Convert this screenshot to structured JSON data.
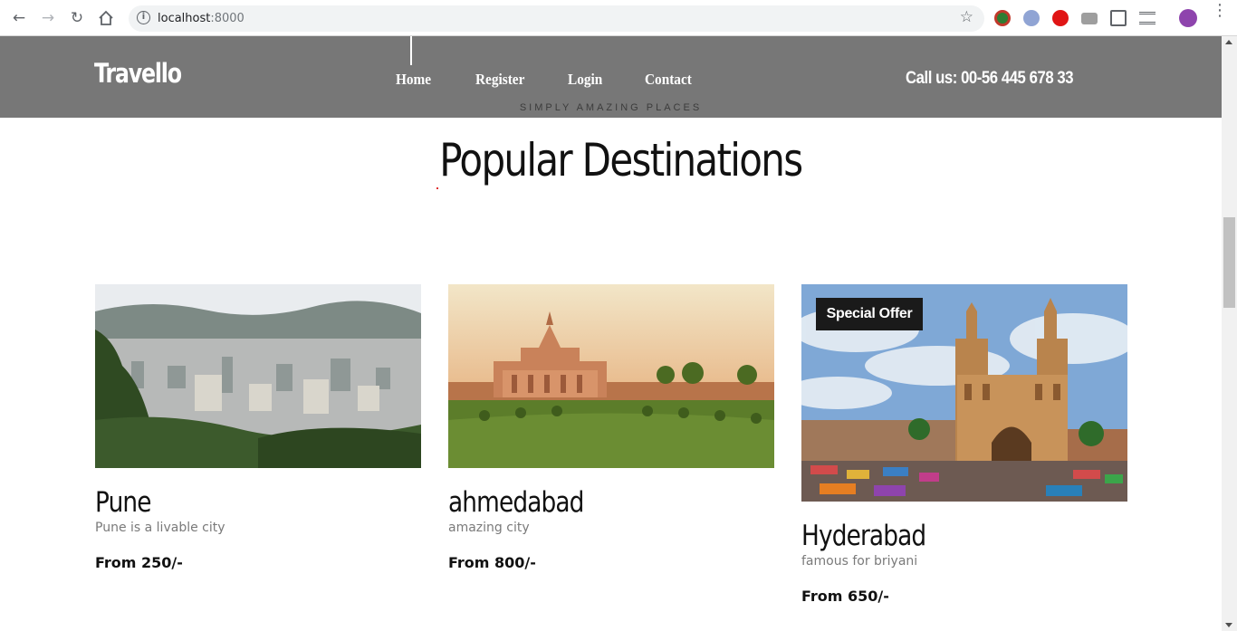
{
  "browser": {
    "url_host": "localhost",
    "url_port": ":8000"
  },
  "header": {
    "logo": "Travello",
    "nav": [
      "Home",
      "Register",
      "Login",
      "Contact"
    ],
    "call": "Call us: 00-56 445 678 33",
    "tagline": "SIMPLY AMAZING PLACES"
  },
  "section": {
    "title": "Popular Destinations"
  },
  "destinations": [
    {
      "name": "Pune",
      "desc": "Pune is a livable city",
      "price": "From 250/-"
    },
    {
      "name": "ahmedabad",
      "desc": "amazing city",
      "price": "From 800/-"
    },
    {
      "name": "Hyderabad",
      "desc": "famous for briyani",
      "price": "From 650/-",
      "badge": "Special Offer"
    }
  ]
}
